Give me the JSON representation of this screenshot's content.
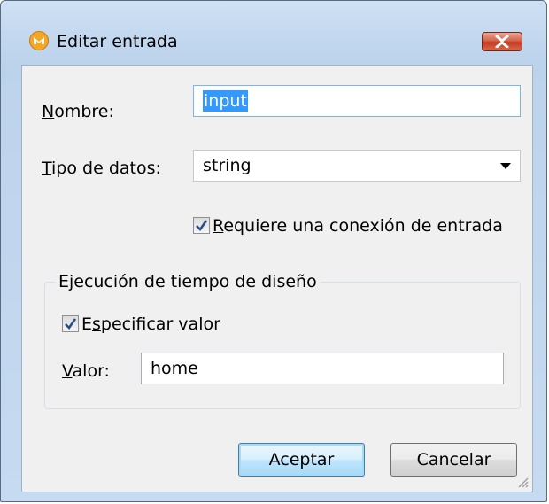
{
  "dialog": {
    "title": "Editar entrada",
    "icon": "mapforce-app-icon",
    "close_icon": "close-icon"
  },
  "form": {
    "name_label_mnemonic": "N",
    "name_label_rest": "ombre:",
    "name_value": "input",
    "type_label_mnemonic": "T",
    "type_label_rest": "ipo de datos:",
    "type_value": "string",
    "requires_connection_mnemonic": "R",
    "requires_connection_rest": "equiere una conexión de entrada",
    "requires_connection_checked": true
  },
  "design_time": {
    "group_title": "Ejecución de tiempo de diseño",
    "specify_value_prefix": "E",
    "specify_value_mnemonic": "s",
    "specify_value_rest": "pecificar valor",
    "specify_value_checked": true,
    "value_label_mnemonic": "V",
    "value_label_rest": "alor:",
    "value": "home"
  },
  "buttons": {
    "ok_label": "Aceptar",
    "cancel_label": "Cancelar"
  },
  "colors": {
    "selection": "#3399ff",
    "title_gradient_top": "#cfe1f4",
    "close_button_red": "#c43a1f",
    "default_button_blue": "#bee6fd"
  }
}
